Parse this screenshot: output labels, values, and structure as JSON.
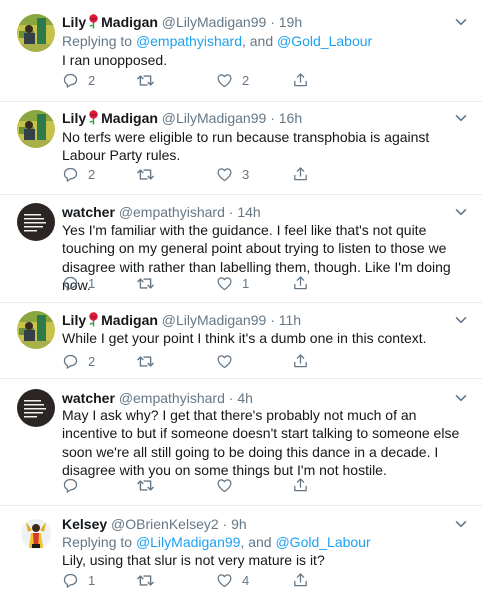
{
  "tweets": [
    {
      "name": "Lily",
      "name_suffix": "Madigan",
      "has_rose": true,
      "handle": "@LilyMadigan99",
      "dot": "·",
      "time": "19h",
      "avatar": "lily-avatar",
      "reply_prefix": "Replying to",
      "reply_to_1": "@empathyishard",
      "reply_join": ", and",
      "reply_to_2": "@Gold_Labour",
      "text": "I ran unopposed.",
      "replies": "2",
      "retweets": "",
      "likes": "2"
    },
    {
      "name": "Lily",
      "name_suffix": "Madigan",
      "has_rose": true,
      "handle": "@LilyMadigan99",
      "dot": "·",
      "time": "16h",
      "avatar": "lily-avatar",
      "text": "No terfs were eligible to run because transphobia is against Labour Party rules.",
      "replies": "2",
      "retweets": "",
      "likes": "3"
    },
    {
      "name": "watcher",
      "handle": "@empathyishard",
      "dot": "·",
      "time": "14h",
      "avatar": "watcher-avatar",
      "text": "Yes I'm familiar with the guidance. I feel like that's not quite touching on my general point about trying to listen to those we disagree with rather than labelling them, though. Like I'm doing now.",
      "replies": "1",
      "retweets": "",
      "likes": "1"
    },
    {
      "name": "Lily",
      "name_suffix": "Madigan",
      "has_rose": true,
      "handle": "@LilyMadigan99",
      "dot": "·",
      "time": "11h",
      "avatar": "lily-avatar",
      "text": "While I get your point I think it's a dumb one in this context.",
      "replies": "2",
      "retweets": "",
      "likes": ""
    },
    {
      "name": "watcher",
      "handle": "@empathyishard",
      "dot": "·",
      "time": "4h",
      "avatar": "watcher-avatar",
      "text": "May I ask why? I get that there's probably not much of an incentive to but if someone doesn't start talking to someone else soon we're all still going to be doing this dance in a decade. I disagree with you on some things but I'm not hostile.",
      "replies": "",
      "retweets": "",
      "likes": ""
    },
    {
      "name": "Kelsey",
      "handle": "@OBrienKelsey2",
      "dot": "·",
      "time": "9h",
      "avatar": "kelsey-avatar",
      "reply_prefix": "Replying to",
      "reply_to_1": "@LilyMadigan99",
      "reply_join": ", and",
      "reply_to_2": "@Gold_Labour",
      "text": "Lily, using that slur is not very mature is it?",
      "replies": "1",
      "retweets": "",
      "likes": "4"
    }
  ],
  "colors": {
    "text": "#14171a",
    "secondary": "#657786",
    "link": "#1da1f2",
    "divider": "#e6ecf0"
  },
  "icons": [
    "reply-icon",
    "retweet-icon",
    "like-icon",
    "share-icon",
    "chevron-down-icon",
    "rose-emoji-icon"
  ]
}
